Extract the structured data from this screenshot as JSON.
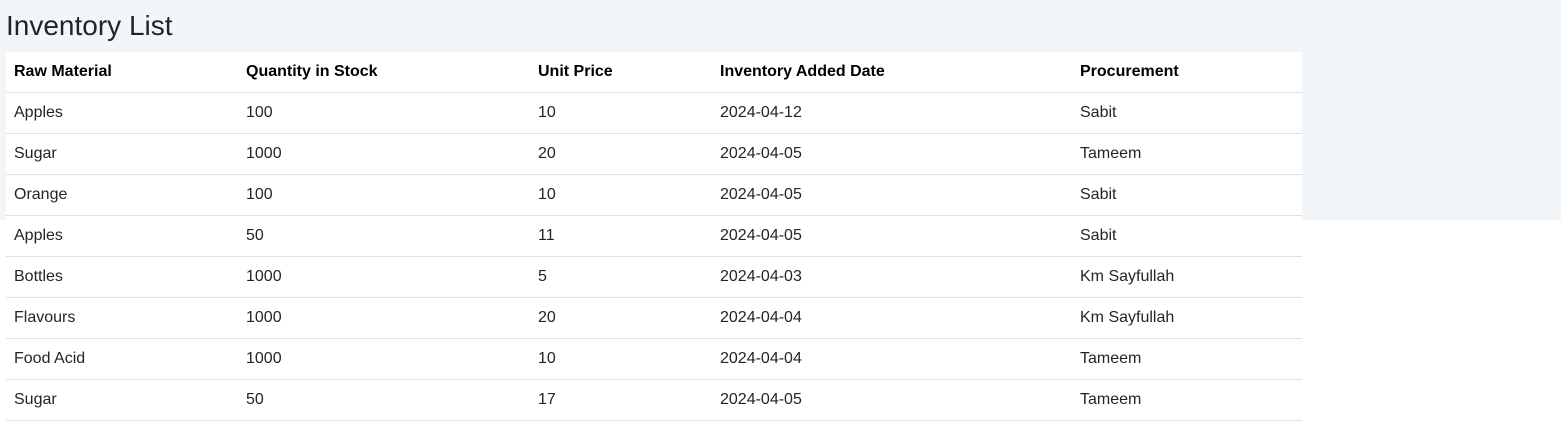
{
  "page": {
    "title": "Inventory List",
    "colors": {
      "page_background": "#f3f6f9",
      "table_background": "#ffffff",
      "row_divider": "#dee2e6",
      "text": "#212529"
    }
  },
  "table": {
    "headers": [
      "Raw Material",
      "Quantity in Stock",
      "Unit Price",
      "Inventory Added Date",
      "Procurement"
    ],
    "rows": [
      [
        "Apples",
        "100",
        "10",
        "2024-04-12",
        "Sabit"
      ],
      [
        "Sugar",
        "1000",
        "20",
        "2024-04-05",
        "Tameem"
      ],
      [
        "Orange",
        "100",
        "10",
        "2024-04-05",
        "Sabit"
      ],
      [
        "Apples",
        "50",
        "11",
        "2024-04-05",
        "Sabit"
      ],
      [
        "Bottles",
        "1000",
        "5",
        "2024-04-03",
        "Km Sayfullah"
      ],
      [
        "Flavours",
        "1000",
        "20",
        "2024-04-04",
        "Km Sayfullah"
      ],
      [
        "Food Acid",
        "1000",
        "10",
        "2024-04-04",
        "Tameem"
      ],
      [
        "Sugar",
        "50",
        "17",
        "2024-04-05",
        "Tameem"
      ]
    ]
  }
}
